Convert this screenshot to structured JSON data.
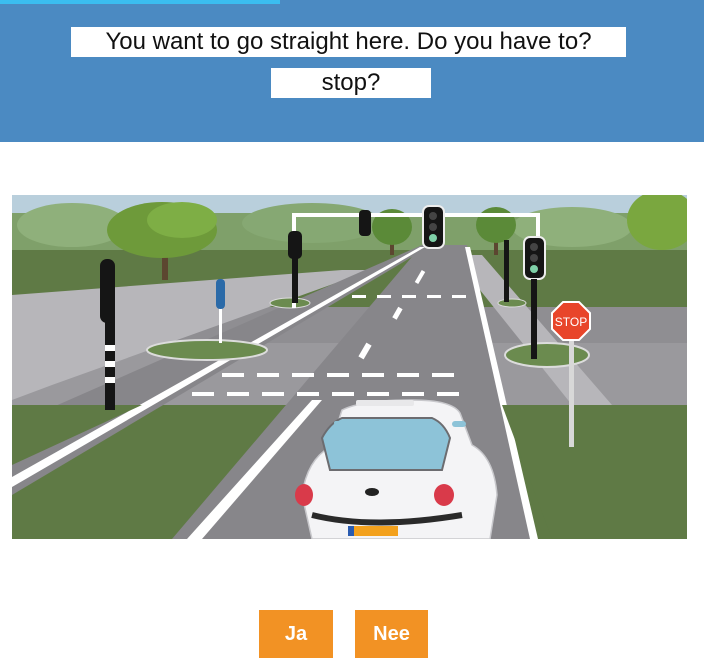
{
  "question": {
    "line1": "You want to go straight here. Do you have to?",
    "line2": "stop?"
  },
  "scene": {
    "stop_sign_text": "STOP"
  },
  "answers": {
    "yes_label": "Ja",
    "no_label": "Nee"
  },
  "colors": {
    "header_bg": "#4b8ac2",
    "button_bg": "#f29224",
    "stop_sign": "#e8452a"
  }
}
